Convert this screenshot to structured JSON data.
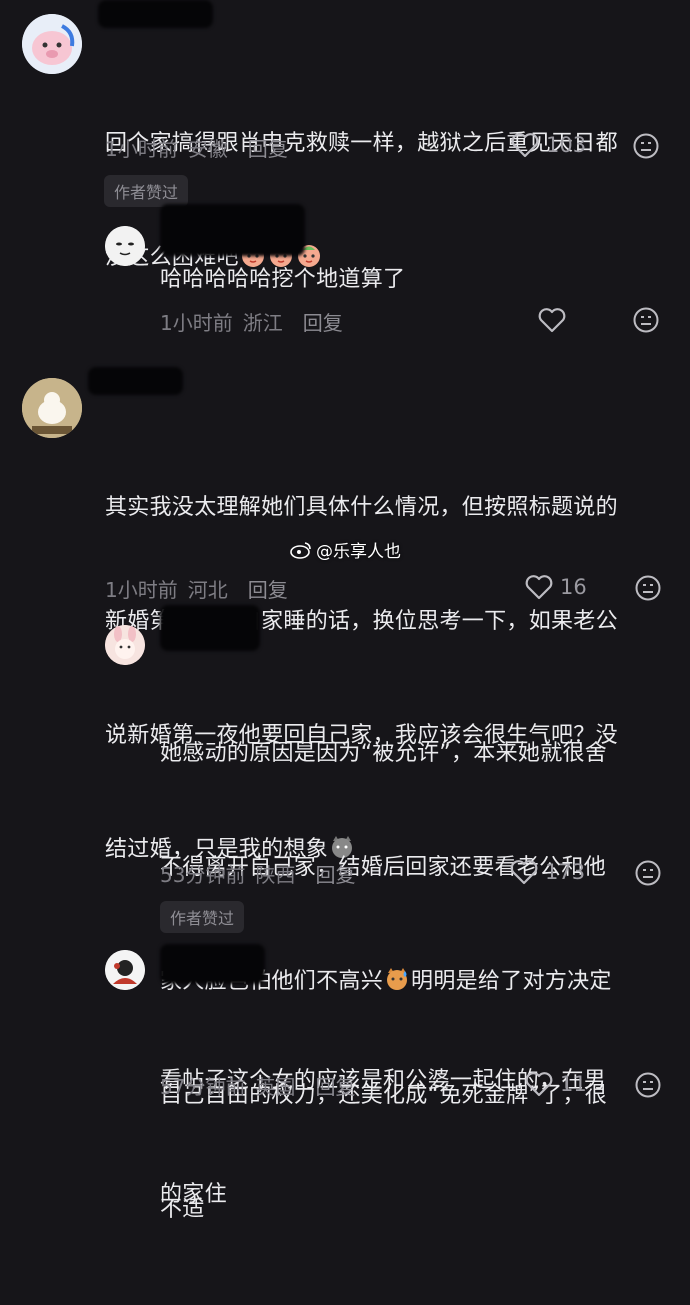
{
  "comments": [
    {
      "text_line1": "回个家搞得跟肖申克救赎一样，越狱之后重见天日都",
      "text_line2": "没这么困难吧",
      "time": "1小时前",
      "location": "安徽",
      "reply_label": "回复",
      "likes": "103",
      "badge": "作者赞过"
    },
    {
      "text": "哈哈哈哈哈挖个地道算了",
      "time": "1小时前",
      "location": "浙江",
      "reply_label": "回复"
    },
    {
      "text_line1": "其实我没太理解她们具体什么情况，但按照标题说的",
      "text_line2": "新婚第一夜回自家睡的话，换位思考一下，如果老公",
      "text_line3": "说新婚第一夜他要回自己家，我应该会很生气吧？没",
      "text_line4": "结过婚，只是我的想象",
      "time": "1小时前",
      "location": "河北",
      "reply_label": "回复",
      "likes": "16"
    },
    {
      "text_line1": "她感动的原因是因为“被允许”，本来她就很舍",
      "text_line2": "不得离开自己家，结婚后回家还要看老公和他",
      "text_line3a": "家人脸色怕他们不高兴",
      "text_line3b": "明明是给了对方决定",
      "text_line4": "自己自由的权力，还美化成“免死金牌”了，很",
      "text_line5": "不适",
      "time": "53分钟前",
      "location": "陕西",
      "reply_label": "回复",
      "likes": "173",
      "badge": "作者赞过"
    },
    {
      "text_line1": "看帖子这个女的应该是和公婆一起住的，在男",
      "text_line2": "的家住",
      "time": "57分钟前",
      "location": "英国",
      "reply_label": "回复",
      "likes": "11"
    }
  ],
  "watermark": {
    "text": "@乐享人也",
    "icon": "weibo-logo-icon"
  },
  "icons": {
    "like": "heart-outline-icon",
    "dislike": "meh-face-icon",
    "emoji": "peach-emoji-icon"
  }
}
